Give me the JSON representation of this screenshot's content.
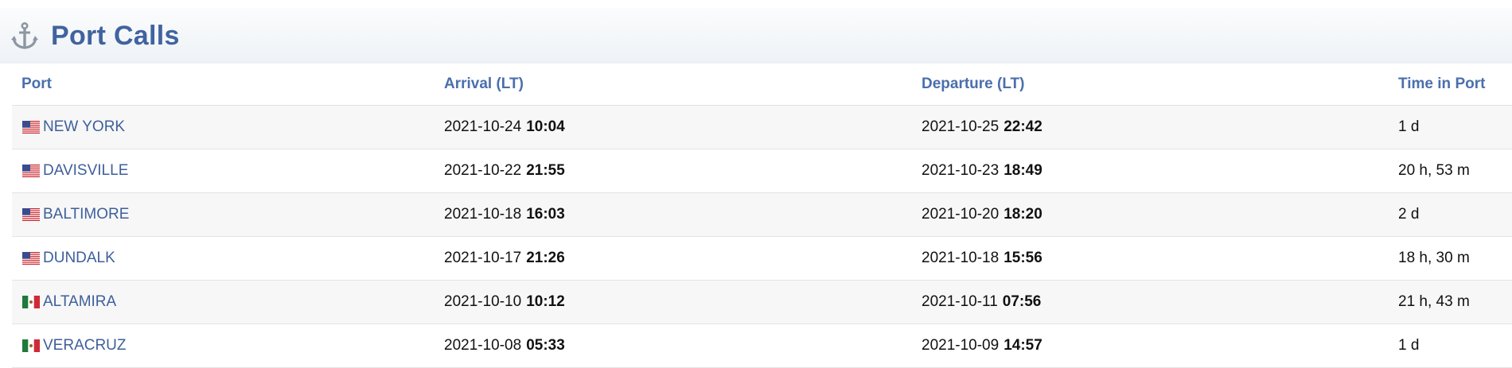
{
  "header": {
    "title": "Port Calls",
    "icon": "anchor-icon"
  },
  "table": {
    "columns": [
      "Port",
      "Arrival (LT)",
      "Departure (LT)",
      "Time in Port"
    ],
    "rows": [
      {
        "flag": "us",
        "port": "NEW YORK",
        "arrival_date": "2021-10-24",
        "arrival_time": "10:04",
        "departure_date": "2021-10-25",
        "departure_time": "22:42",
        "time_in_port": "1 d"
      },
      {
        "flag": "us",
        "port": "DAVISVILLE",
        "arrival_date": "2021-10-22",
        "arrival_time": "21:55",
        "departure_date": "2021-10-23",
        "departure_time": "18:49",
        "time_in_port": "20 h, 53 m"
      },
      {
        "flag": "us",
        "port": "BALTIMORE",
        "arrival_date": "2021-10-18",
        "arrival_time": "16:03",
        "departure_date": "2021-10-20",
        "departure_time": "18:20",
        "time_in_port": "2 d"
      },
      {
        "flag": "us",
        "port": "DUNDALK",
        "arrival_date": "2021-10-17",
        "arrival_time": "21:26",
        "departure_date": "2021-10-18",
        "departure_time": "15:56",
        "time_in_port": "18 h, 30 m"
      },
      {
        "flag": "mx",
        "port": "ALTAMIRA",
        "arrival_date": "2021-10-10",
        "arrival_time": "10:12",
        "departure_date": "2021-10-11",
        "departure_time": "07:56",
        "time_in_port": "21 h, 43 m"
      },
      {
        "flag": "mx",
        "port": "VERACRUZ",
        "arrival_date": "2021-10-08",
        "arrival_time": "05:33",
        "departure_date": "2021-10-09",
        "departure_time": "14:57",
        "time_in_port": "1 d"
      }
    ]
  },
  "colors": {
    "title": "#41639f",
    "header_text": "#4a6fac",
    "link": "#3e5f9b",
    "stripe": "#f7f7f7"
  }
}
